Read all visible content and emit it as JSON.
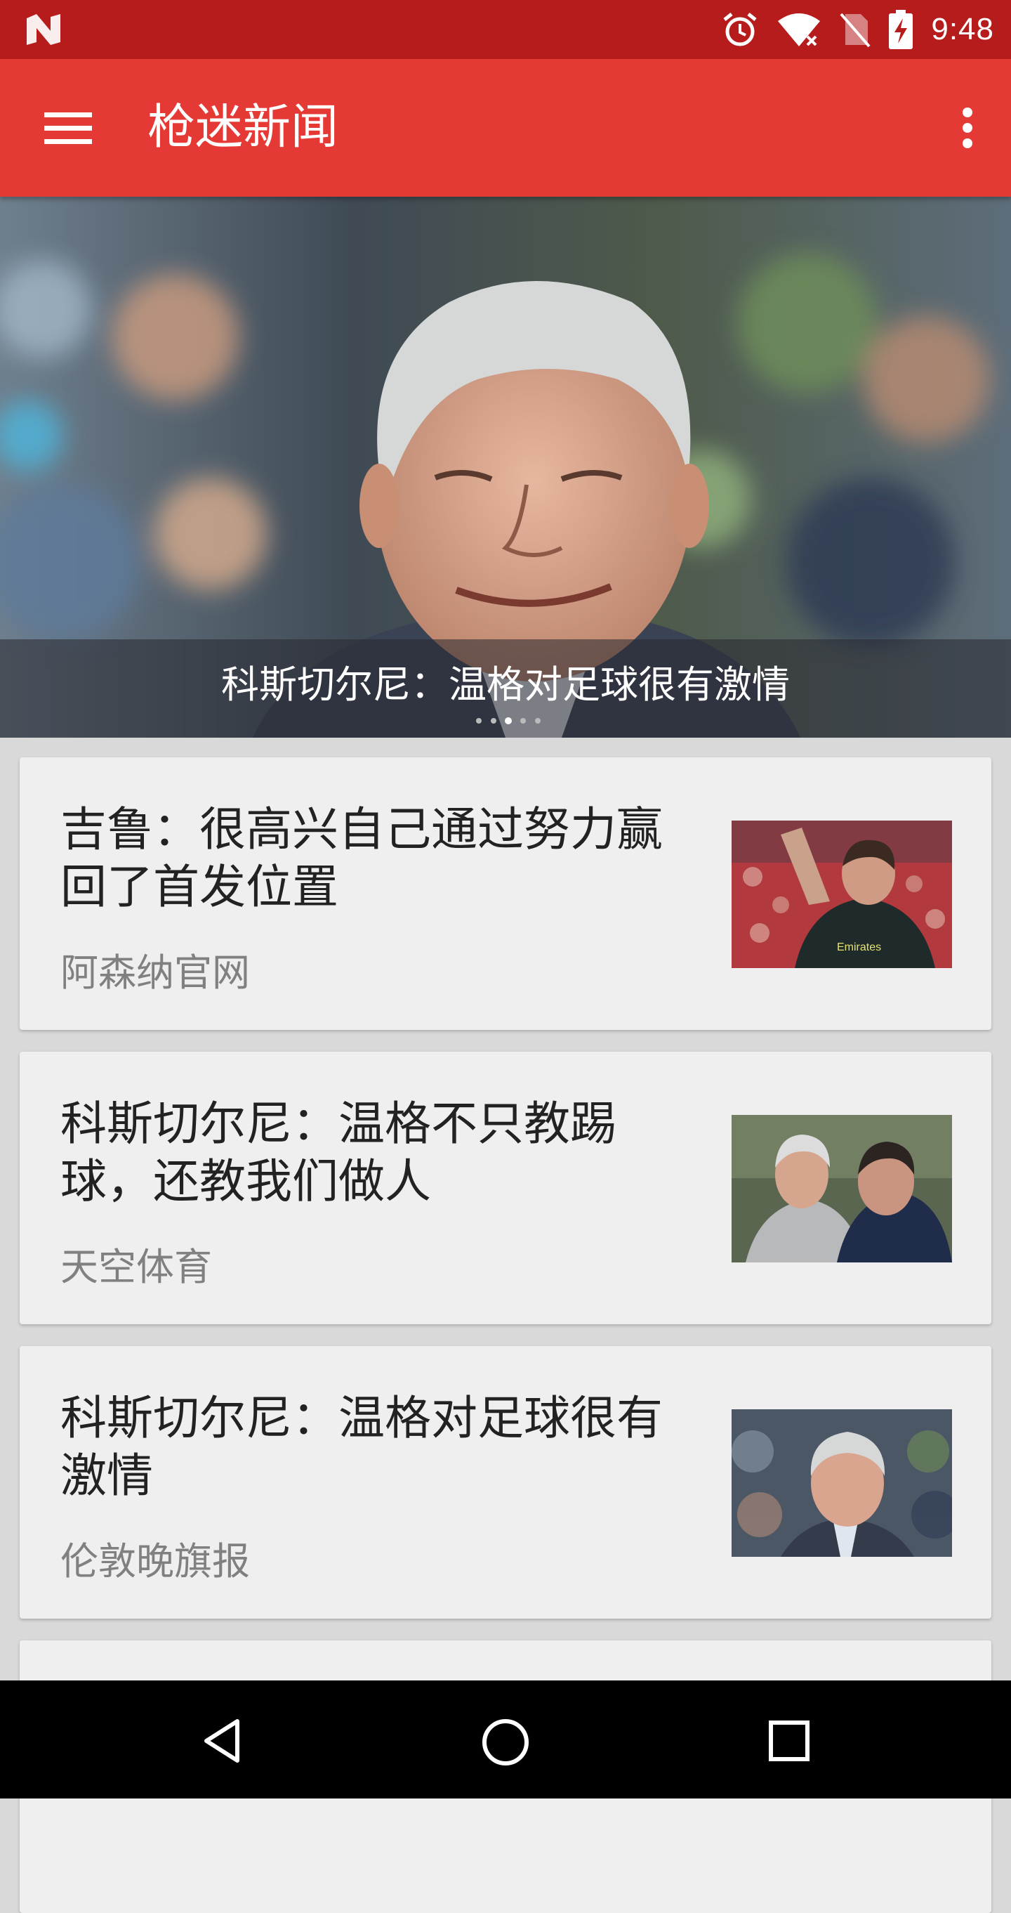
{
  "status_bar": {
    "time": "9:48",
    "icons": [
      "notification-n-icon",
      "alarm-icon",
      "wifi-icon",
      "no-sim-icon",
      "battery-charging-icon"
    ]
  },
  "app_bar": {
    "title": "枪迷新闻",
    "menu_icon": "hamburger-menu-icon",
    "more_icon": "more-vert-icon"
  },
  "hero": {
    "caption": "科斯切尔尼：温格对足球很有激情",
    "dots_count": 5,
    "active_dot": 2
  },
  "news": [
    {
      "title": "吉鲁：很高兴自己通过努力赢回了首发位置",
      "source": "阿森纳官网"
    },
    {
      "title": "科斯切尔尼：温格不只教踢球，还教我们做人",
      "source": "天空体育"
    },
    {
      "title": "科斯切尔尼：温格对足球很有激情",
      "source": "伦敦晚旗报"
    }
  ],
  "colors": {
    "status_bar": "#b71c1c",
    "app_bar": "#e53935",
    "card_bg": "#efefef",
    "list_bg": "#d9d9d9"
  }
}
